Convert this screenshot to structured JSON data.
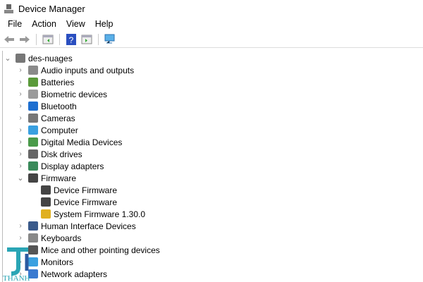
{
  "window": {
    "title": "Device Manager"
  },
  "menu": [
    "File",
    "Action",
    "View",
    "Help"
  ],
  "toolbar": [
    "back-icon",
    "forward-icon",
    "show-hide-console-tree-icon",
    "help-icon",
    "action-pane-icon",
    "scan-hardware-icon"
  ],
  "tree": {
    "root": "des-nuages",
    "items": [
      {
        "label": "Audio inputs and outputs",
        "icon": "speaker-icon",
        "color": "#8a8a8a",
        "expanded": false
      },
      {
        "label": "Batteries",
        "icon": "battery-icon",
        "color": "#5a9a3a",
        "expanded": false
      },
      {
        "label": "Biometric devices",
        "icon": "fingerprint-icon",
        "color": "#9a9a9a",
        "expanded": false
      },
      {
        "label": "Bluetooth",
        "icon": "bluetooth-icon",
        "color": "#1e6fd0",
        "expanded": false
      },
      {
        "label": "Cameras",
        "icon": "camera-icon",
        "color": "#777777",
        "expanded": false
      },
      {
        "label": "Computer",
        "icon": "computer-icon",
        "color": "#3aa0e0",
        "expanded": false
      },
      {
        "label": "Digital Media Devices",
        "icon": "media-device-icon",
        "color": "#4a9a4a",
        "expanded": false
      },
      {
        "label": "Disk drives",
        "icon": "disk-drive-icon",
        "color": "#666666",
        "expanded": false
      },
      {
        "label": "Display adapters",
        "icon": "display-adapter-icon",
        "color": "#3a8a5a",
        "expanded": false
      },
      {
        "label": "Firmware",
        "icon": "firmware-icon",
        "color": "#444444",
        "expanded": true,
        "children": [
          {
            "label": "Device Firmware",
            "icon": "firmware-icon",
            "color": "#444444"
          },
          {
            "label": "Device Firmware",
            "icon": "firmware-icon",
            "color": "#444444"
          },
          {
            "label": "System Firmware 1.30.0",
            "icon": "firmware-warning-icon",
            "color": "#e0b020"
          }
        ]
      },
      {
        "label": "Human Interface Devices",
        "icon": "hid-icon",
        "color": "#3a5a8a",
        "expanded": false
      },
      {
        "label": "Keyboards",
        "icon": "keyboard-icon",
        "color": "#888888",
        "expanded": false
      },
      {
        "label": "Mice and other pointing devices",
        "icon": "mouse-icon",
        "color": "#555555",
        "expanded": false
      },
      {
        "label": "Monitors",
        "icon": "monitor-icon",
        "color": "#3aa0e0",
        "expanded": false
      },
      {
        "label": "Network adapters",
        "icon": "network-adapter-icon",
        "color": "#3a7ad0",
        "expanded": false
      }
    ]
  },
  "watermark": {
    "text": "THANH"
  }
}
